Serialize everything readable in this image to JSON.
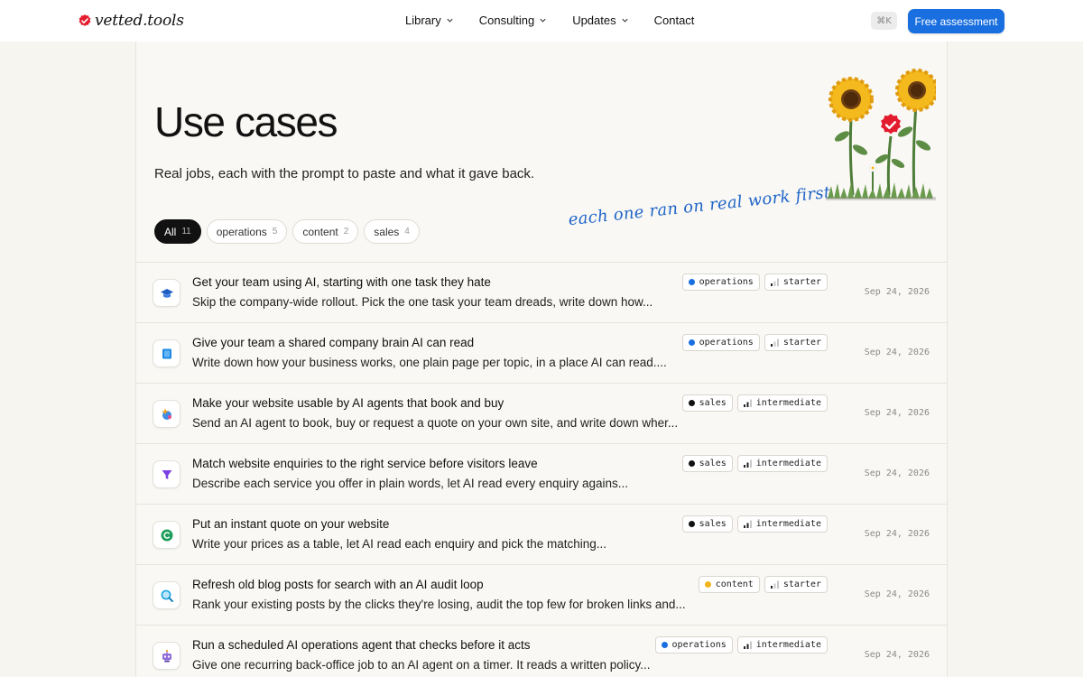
{
  "brand": {
    "name": "vetted.tools"
  },
  "nav": {
    "links": [
      {
        "label": "Library",
        "dropdown": true
      },
      {
        "label": "Consulting",
        "dropdown": true
      },
      {
        "label": "Updates",
        "dropdown": true
      },
      {
        "label": "Contact",
        "dropdown": false
      }
    ],
    "shortcut": "⌘K",
    "cta_label": "Free assessment"
  },
  "header": {
    "title": "Use cases",
    "subtitle": "Real jobs, each with the prompt to paste and what it gave back.",
    "handwritten_note": "each one ran on real work first"
  },
  "filters": [
    {
      "label": "All",
      "count": "11",
      "active": true
    },
    {
      "label": "operations",
      "count": "5",
      "active": false
    },
    {
      "label": "content",
      "count": "2",
      "active": false
    },
    {
      "label": "sales",
      "count": "4",
      "active": false
    }
  ],
  "category_colors": {
    "operations": "#1a6fe0",
    "sales": "#111111",
    "content": "#f2b51d"
  },
  "accent_color": "#1a6fe0",
  "use_cases": [
    {
      "icon": "graduation-cap-icon",
      "title": "Get your team using AI, starting with one task they hate",
      "description": "Skip the company-wide rollout. Pick the one task your team dreads, write down how...",
      "category": "operations",
      "level": "starter",
      "level_bars": 1,
      "date": "Sep 24, 2026"
    },
    {
      "icon": "book-icon",
      "title": "Give your team a shared company brain AI can read",
      "description": "Write down how your business works, one plain page per topic, in a place AI can read....",
      "category": "operations",
      "level": "starter",
      "level_bars": 1,
      "date": "Sep 24, 2026"
    },
    {
      "icon": "agent-sparkle-icon",
      "title": "Make your website usable by AI agents that book and buy",
      "description": "Send an AI agent to book, buy or request a quote on your own site, and write down wher...",
      "category": "sales",
      "level": "intermediate",
      "level_bars": 2,
      "date": "Sep 24, 2026"
    },
    {
      "icon": "funnel-icon",
      "title": "Match website enquiries to the right service before visitors leave",
      "description": "Describe each service you offer in plain words, let AI read every enquiry agains...",
      "category": "sales",
      "level": "intermediate",
      "level_bars": 2,
      "date": "Sep 24, 2026"
    },
    {
      "icon": "quote-coin-icon",
      "title": "Put an instant quote on your website",
      "description": "Write your prices as a table, let AI read each enquiry and pick the matching...",
      "category": "sales",
      "level": "intermediate",
      "level_bars": 2,
      "date": "Sep 24, 2026"
    },
    {
      "icon": "magnifier-icon",
      "title": "Refresh old blog posts for search with an AI audit loop",
      "description": "Rank your existing posts by the clicks they're losing, audit the top few for broken links and...",
      "category": "content",
      "level": "starter",
      "level_bars": 1,
      "date": "Sep 24, 2026"
    },
    {
      "icon": "robot-icon",
      "title": "Run a scheduled AI operations agent that checks before it acts",
      "description": "Give one recurring back-office job to an AI agent on a timer. It reads a written policy...",
      "category": "operations",
      "level": "intermediate",
      "level_bars": 2,
      "date": "Sep 24, 2026"
    }
  ]
}
